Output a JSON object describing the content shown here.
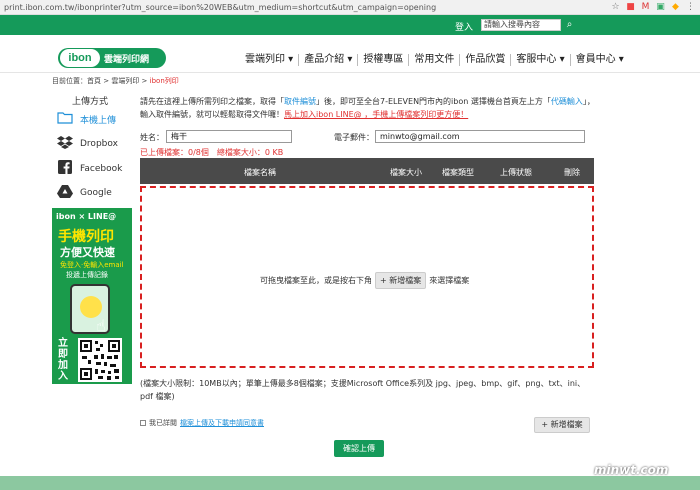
{
  "browser": {
    "url": "print.ibon.com.tw/ibonprinter?utm_source=ibon%20WEB&utm_medium=shortcut&utm_campaign=opening"
  },
  "topbar": {
    "login": "登入",
    "search_placeholder": "請輸入搜尋內容"
  },
  "header": {
    "logo_mark": "ibon",
    "logo_text": "雲端列印網",
    "nav": [
      {
        "label": "雲端列印 ▾"
      },
      {
        "label": "產品介紹 ▾"
      },
      {
        "label": "授權專區"
      },
      {
        "label": "常用文件"
      },
      {
        "label": "作品欣賞"
      },
      {
        "label": "客服中心 ▾"
      },
      {
        "label": "會員中心 ▾"
      }
    ]
  },
  "breadcrumb": {
    "prefix": "目前位置：",
    "home": "首頁",
    "sep": " > ",
    "section": "雲端列印",
    "current": "ibon列印"
  },
  "sidebar": {
    "title": "上傳方式",
    "items": [
      {
        "label": "本機上傳",
        "icon": "folder-icon"
      },
      {
        "label": "Dropbox",
        "icon": "dropbox-icon"
      },
      {
        "label": "Facebook",
        "icon": "facebook-icon"
      },
      {
        "label": "Google",
        "icon": "google-drive-icon"
      }
    ],
    "ad": {
      "top": "ibon × LINE@",
      "line1": "手機列印",
      "line2": "方便又快速",
      "line3": "免登入·免輸入email",
      "line4": "投遞上傳記錄",
      "side": "立即加入"
    }
  },
  "notice": {
    "p1": "請先在這裡上傳所需列印之檔案，取得「",
    "link1": "取件編號",
    "p2": "」後，即可至全台7-ELEVEN門市內的ibon 選擇機台首頁左上方「",
    "link2": "代碼輸入",
    "p3": "」，輸入取件編號，就可以輕鬆取得文件囉！",
    "link3": "馬上加入ibon LINE@ ，手機上傳檔案列印更方便！"
  },
  "form": {
    "name_label": "姓名：",
    "name_value": "梅干",
    "email_label": "電子郵件：",
    "email_value": "minwto@gmail.com",
    "stats": "已上傳檔案：0/8個　總檔案大小：0 KB"
  },
  "table": {
    "headers": [
      "檔案名稱",
      "檔案大小",
      "檔案類型",
      "上傳狀態",
      "刪除"
    ]
  },
  "dropzone": {
    "text_before": "可拖曳檔案至此，或是按右下角",
    "button": "+ 新增檔案",
    "text_after": "來選擇檔案"
  },
  "limits": "(檔案大小限制：10MB以內；單筆上傳最多8個檔案；支援Microsoft Office系列及 jpg、jpeg、bmp、gif、png、txt、ini、pdf 檔案)",
  "agree": {
    "label": "我已詳閱",
    "link": "檔案上傳及下載申請同意書"
  },
  "actions": {
    "add_file": "+ 新增檔案",
    "confirm": "確認上傳"
  },
  "watermark": "minwt.com",
  "colors": {
    "brand_green": "#159a5a",
    "link_blue": "#1e8fd8",
    "alert_red": "#e03030"
  }
}
